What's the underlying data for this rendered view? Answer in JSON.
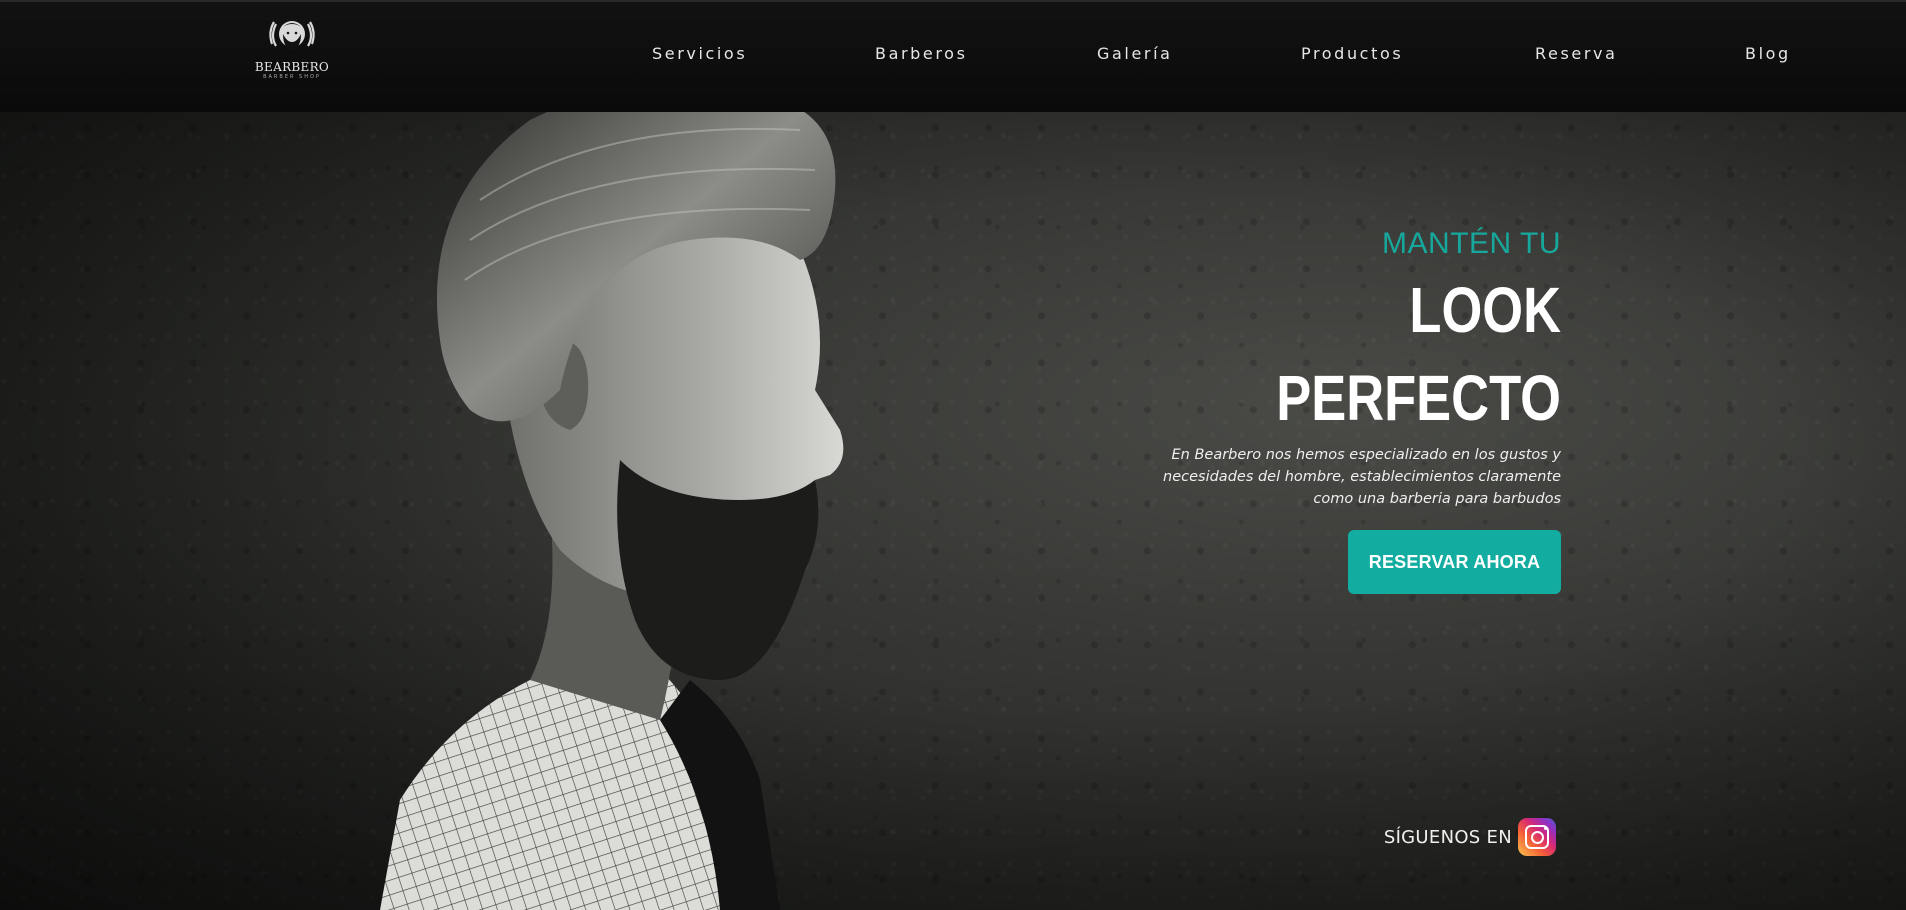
{
  "brand": {
    "name": "BEARBERO",
    "sub": "BARBER SHOP"
  },
  "nav": {
    "items": [
      {
        "label": "Servicios"
      },
      {
        "label": "Barberos"
      },
      {
        "label": "Galería"
      },
      {
        "label": "Productos"
      },
      {
        "label": "Reserva"
      },
      {
        "label": "Blog"
      }
    ]
  },
  "hero": {
    "kicker": "MANTÉN TU",
    "headline_line1": "LOOK",
    "headline_line2": "PERFECTO",
    "description": "En Bearbero nos hemos especializado en los gustos y necesidades del hombre, establecimientos claramente como una barberia para barbudos",
    "cta_label": "RESERVAR AHORA"
  },
  "social": {
    "label": "SÍGUENOS EN",
    "icon": "instagram-icon"
  },
  "colors": {
    "accent": "#12aca1",
    "kicker": "#17a89d",
    "header_bg": "#0a0a0a",
    "text": "#ffffff"
  }
}
